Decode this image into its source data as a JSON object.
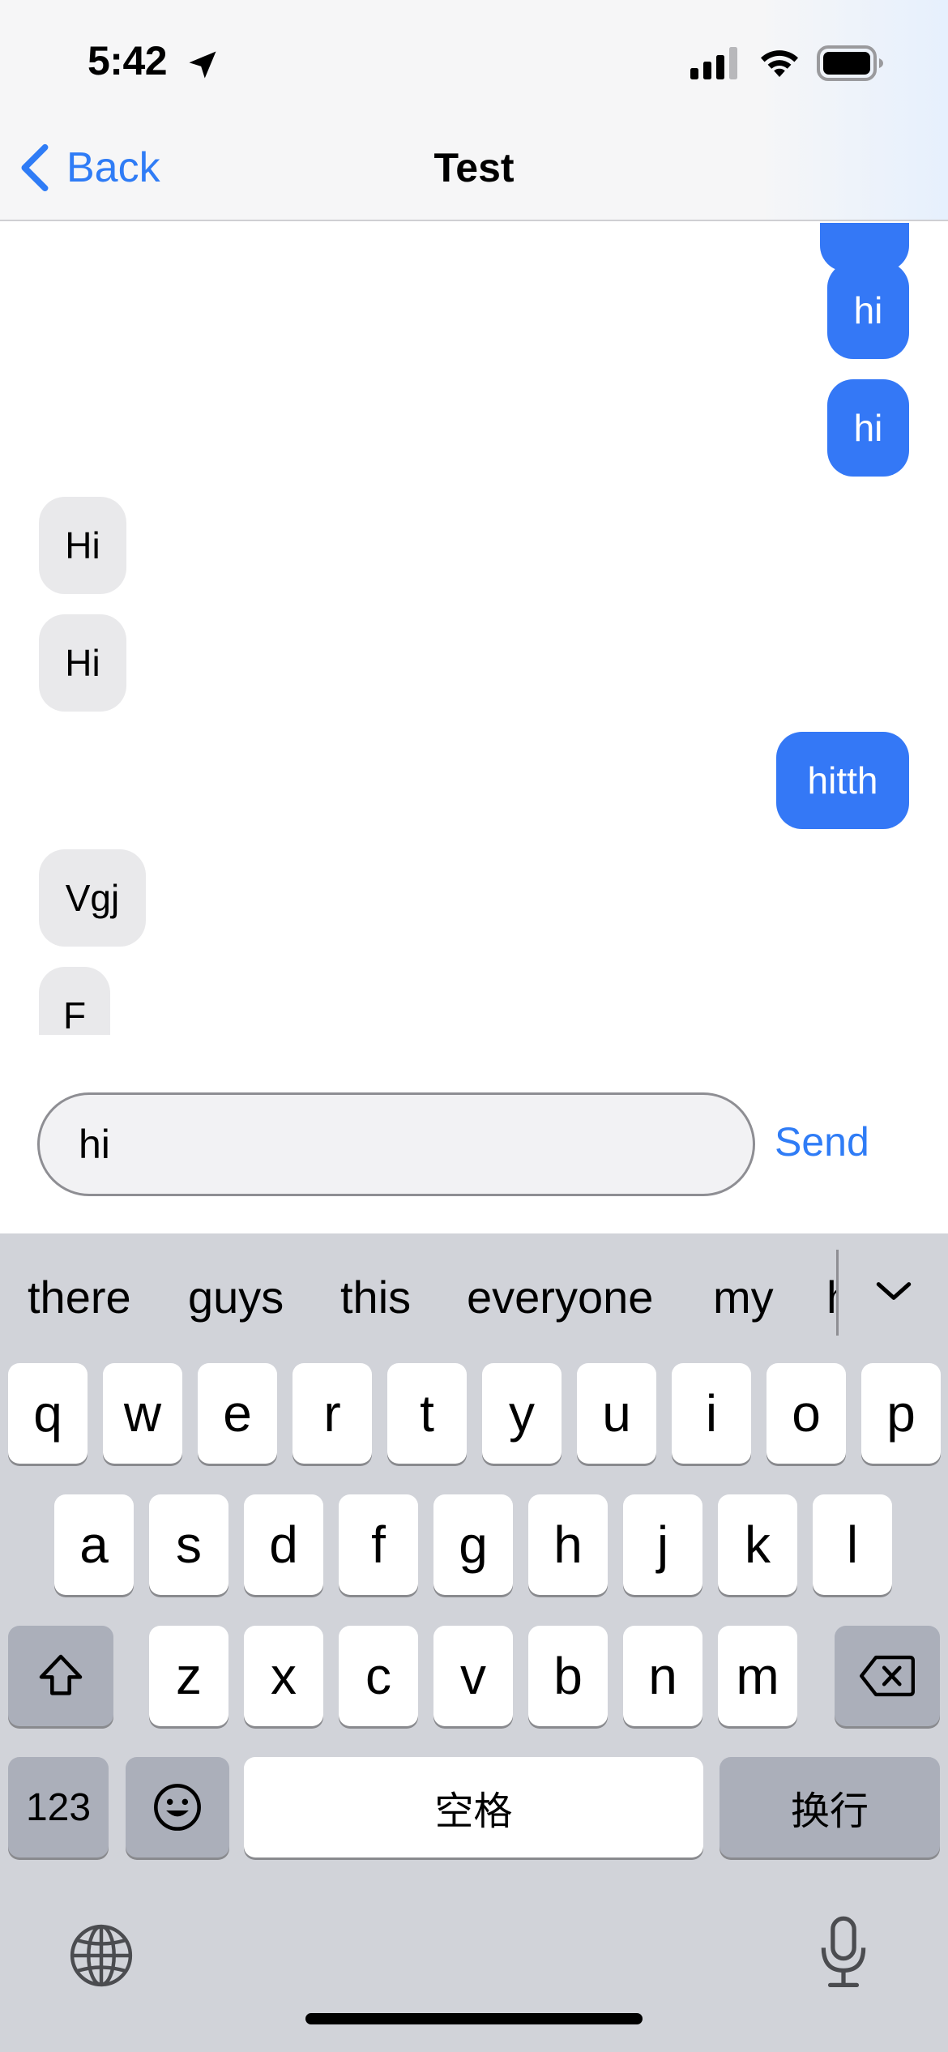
{
  "status_bar": {
    "time": "5:42"
  },
  "nav": {
    "back_label": "Back",
    "title": "Test"
  },
  "messages": [
    {
      "text": "",
      "direction": "sent"
    },
    {
      "text": "hi",
      "direction": "sent"
    },
    {
      "text": "hi",
      "direction": "sent"
    },
    {
      "text": "Hi",
      "direction": "received"
    },
    {
      "text": "Hi",
      "direction": "received"
    },
    {
      "text": "hitth",
      "direction": "sent"
    },
    {
      "text": "Vgj",
      "direction": "received"
    },
    {
      "text": "F",
      "direction": "received"
    }
  ],
  "composer": {
    "input_value": "hi",
    "send_label": "Send"
  },
  "keyboard": {
    "suggestions": [
      "there",
      "guys",
      "this",
      "everyone",
      "my",
      "h"
    ],
    "row1": [
      "q",
      "w",
      "e",
      "r",
      "t",
      "y",
      "u",
      "i",
      "o",
      "p"
    ],
    "row2": [
      "a",
      "s",
      "d",
      "f",
      "g",
      "h",
      "j",
      "k",
      "l"
    ],
    "row3": [
      "z",
      "x",
      "c",
      "v",
      "b",
      "n",
      "m"
    ],
    "numbers_label": "123",
    "space_label": "空格",
    "return_label": "换行"
  },
  "colors": {
    "accent": "#2f7cf6",
    "sent_bubble": "#3478f6",
    "received_bubble": "#e9e9eb",
    "keyboard_bg": "#d1d3d9"
  }
}
